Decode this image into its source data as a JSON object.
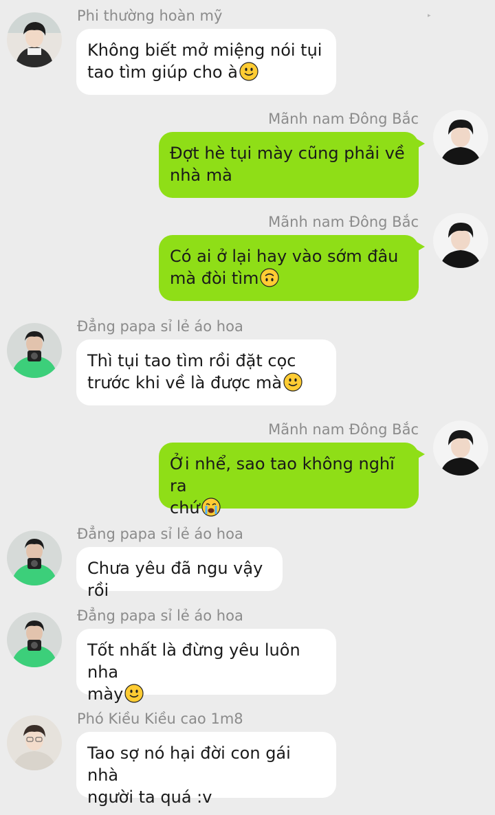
{
  "indicator": "▸",
  "messages": [
    {
      "name": "Phi thường hoàn mỹ",
      "line1": "Không biết mở miệng nói tụi",
      "line2": "tao tìm giúp cho à",
      "emoji": "slightly-smiling-face"
    },
    {
      "name": "Mãnh nam Đông Bắc",
      "line1": "Đợt hè tụi mày cũng phải về",
      "line2": "nhà mà",
      "emoji": ""
    },
    {
      "name": "Mãnh nam Đông Bắc",
      "line1": "Có ai ở lại hay vào sớm đâu",
      "line2": "mà đòi tìm",
      "emoji": "upside-down-face"
    },
    {
      "name": "Đẳng papa sỉ lẻ áo hoa",
      "line1": "Thì tụi tao tìm rồi đặt cọc",
      "line2": "trước khi về là được mà",
      "emoji": "slightly-smiling-face"
    },
    {
      "name": "Mãnh nam Đông Bắc",
      "line1": "Ởi nhể, sao tao không nghĩ ra",
      "line2": "chứ",
      "emoji": "loudly-crying-face"
    },
    {
      "name": "Đẳng papa sỉ lẻ áo hoa",
      "line1": "Chưa yêu đã ngu vậy rồi",
      "line2": "",
      "emoji": ""
    },
    {
      "name": "Đẳng papa sỉ lẻ áo hoa",
      "line1": "Tốt nhất là đừng yêu luôn nha",
      "line2": "mày",
      "emoji": "slightly-smiling-face"
    },
    {
      "name": "Phó Kiều Kiều cao 1m8",
      "line1": "Tao sợ nó hại đời con gái nhà",
      "line2": "người ta quá :v",
      "emoji": ""
    }
  ],
  "colors": {
    "background": "#ececec",
    "incoming_bubble": "#ffffff",
    "outgoing_bubble": "#8fde17",
    "name_text": "#8b8b8b",
    "message_text": "#1a1a1a"
  }
}
